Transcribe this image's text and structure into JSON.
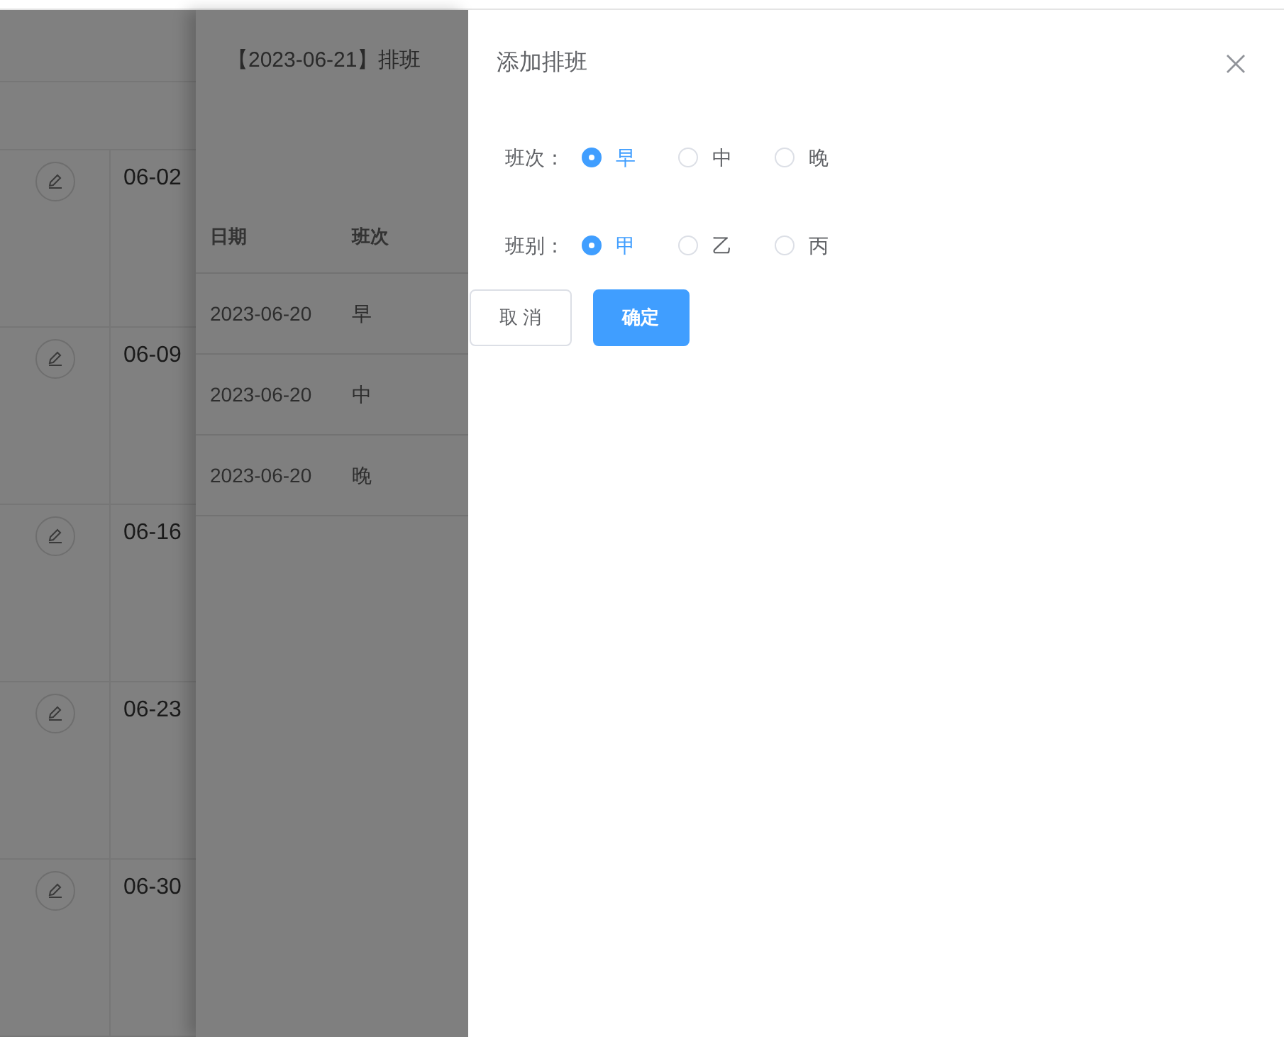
{
  "calendar": {
    "rows": [
      {
        "date": "06-02"
      },
      {
        "date": "06-09"
      },
      {
        "date": "06-16"
      },
      {
        "date": "06-23"
      },
      {
        "date": "06-30"
      }
    ]
  },
  "schedule_drawer": {
    "title": "【2023-06-21】排班",
    "columns": [
      "日期",
      "班次"
    ],
    "rows": [
      [
        "2023-06-20",
        "早"
      ],
      [
        "2023-06-20",
        "中"
      ],
      [
        "2023-06-20",
        "晚"
      ]
    ]
  },
  "dialog": {
    "title": "添加排班",
    "fields": [
      {
        "label": "班次：",
        "options": [
          {
            "label": "早",
            "selected": true
          },
          {
            "label": "中",
            "selected": false
          },
          {
            "label": "晚",
            "selected": false
          }
        ]
      },
      {
        "label": "班别：",
        "options": [
          {
            "label": "甲",
            "selected": true
          },
          {
            "label": "乙",
            "selected": false
          },
          {
            "label": "丙",
            "selected": false
          }
        ]
      }
    ],
    "buttons": [
      {
        "label": "取 消",
        "kind": "secondary"
      },
      {
        "label": "确定",
        "kind": "primary"
      }
    ]
  }
}
